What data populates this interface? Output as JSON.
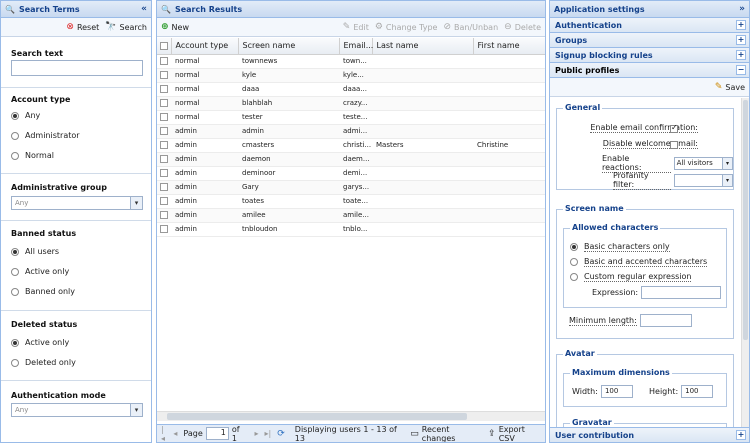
{
  "search_terms": {
    "title": "Search Terms",
    "collapse_glyph": "«",
    "reset_label": "Reset",
    "search_label": "Search",
    "search_text_label": "Search text",
    "search_text_value": "",
    "account_type_label": "Account type",
    "account_type_options": [
      "Any",
      "Administrator",
      "Normal"
    ],
    "account_type_selected": "Any",
    "admin_group_label": "Administrative group",
    "admin_group_value": "Any",
    "banned_status_label": "Banned status",
    "banned_options": [
      "All users",
      "Active only",
      "Banned only"
    ],
    "banned_selected": "All users",
    "deleted_status_label": "Deleted status",
    "deleted_options": [
      "Active only",
      "Deleted only"
    ],
    "deleted_selected": "Active only",
    "auth_mode_label": "Authentication mode",
    "auth_mode_value": "Any"
  },
  "search_results": {
    "title": "Search Results",
    "new_label": "New",
    "edit_label": "Edit",
    "change_type_label": "Change Type",
    "ban_label": "Ban/Unban",
    "delete_label": "Delete",
    "columns": [
      "Account type",
      "Screen name",
      "Email...",
      "Last name",
      "First name"
    ],
    "rows": [
      [
        "normal",
        "townnews",
        "town...",
        "",
        ""
      ],
      [
        "normal",
        "kyle",
        "kyle...",
        "",
        ""
      ],
      [
        "normal",
        "daaa",
        "daaa...",
        "",
        ""
      ],
      [
        "normal",
        "blahblah",
        "crazy...",
        "",
        ""
      ],
      [
        "normal",
        "tester",
        "teste...",
        "",
        ""
      ],
      [
        "admin",
        "admin",
        "admi...",
        "",
        ""
      ],
      [
        "admin",
        "cmasters",
        "christi...",
        "Masters",
        "Christine"
      ],
      [
        "admin",
        "daemon",
        "daem...",
        "",
        ""
      ],
      [
        "admin",
        "deminoor",
        "demi...",
        "",
        ""
      ],
      [
        "admin",
        "Gary",
        "garys...",
        "",
        ""
      ],
      [
        "admin",
        "toates",
        "toate...",
        "",
        ""
      ],
      [
        "admin",
        "amilee",
        "amile...",
        "",
        ""
      ],
      [
        "admin",
        "tnbloudon",
        "tnblo...",
        "",
        ""
      ]
    ],
    "pager": {
      "page_label": "Page",
      "page_value": "1",
      "of_label": "of 1",
      "display_text": "Displaying users 1 - 13 of 13",
      "recent_changes_label": "Recent changes",
      "export_label": "Export CSV"
    }
  },
  "app_settings": {
    "title": "Application settings",
    "collapse_glyph": "»",
    "sections": [
      "Authentication",
      "Groups",
      "Signup blocking rules"
    ],
    "plus_glyph": "+",
    "minus_glyph": "−",
    "active_section": "Public profiles",
    "save_label": "Save",
    "general": {
      "legend": "General",
      "enable_email_label": "Enable email confirmation:",
      "enable_email_checked": true,
      "disable_welcome_label": "Disable welcome email:",
      "disable_welcome_checked": false,
      "reactions_label": "Enable reactions:",
      "reactions_value": "All visitors",
      "profanity_label": "Profanity filter:",
      "profanity_value": ""
    },
    "screen_name": {
      "legend": "Screen name",
      "allowed_legend": "Allowed characters",
      "options": [
        "Basic characters only",
        "Basic and accented characters",
        "Custom regular expression"
      ],
      "selected": "Basic characters only",
      "expression_label": "Expression:",
      "expression_value": "",
      "min_length_label": "Minimum length:",
      "min_length_value": ""
    },
    "avatar": {
      "legend": "Avatar",
      "max_dim_legend": "Maximum dimensions",
      "width_label": "Width:",
      "width_value": "100",
      "height_label": "Height:",
      "height_value": "100",
      "gravatar_legend": "Gravatar"
    },
    "bottom_section": "User contribution"
  }
}
